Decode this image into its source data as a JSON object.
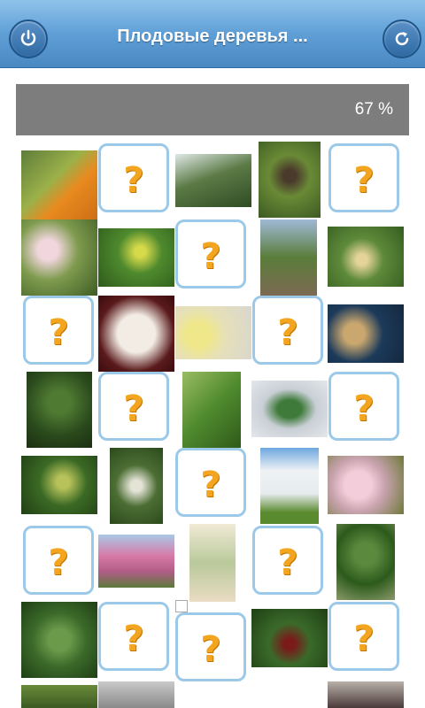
{
  "header": {
    "title": "Плодовые деревья ...",
    "left_icon": "power-icon",
    "right_icon": "refresh-icon"
  },
  "progress": {
    "label": "67 %",
    "value": 0.67
  },
  "colors": {
    "header": "#5f9fd6",
    "progress": "#7d7d7d",
    "card_border": "#9cc9e8",
    "question": "#f3a51f"
  },
  "cards": {
    "question_mark": "?"
  }
}
